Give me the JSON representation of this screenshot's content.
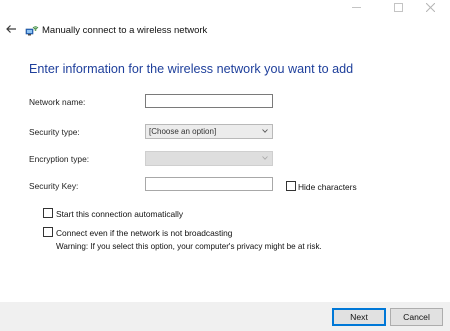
{
  "window": {
    "title": "Manually connect to a wireless network",
    "controls": {
      "minimize_icon": "minimize-icon",
      "maximize_icon": "maximize-icon",
      "close_icon": "close-icon"
    }
  },
  "nav": {
    "back_icon": "back-arrow-icon"
  },
  "heading": "Enter information for the wireless network you want to add",
  "form": {
    "network_name": {
      "label": "Network name:",
      "value": ""
    },
    "security_type": {
      "label": "Security type:",
      "selected": "[Choose an option]"
    },
    "encryption_type": {
      "label": "Encryption type:",
      "selected": "",
      "disabled": true
    },
    "security_key": {
      "label": "Security Key:",
      "value": ""
    },
    "hide_characters": {
      "label": "Hide characters",
      "checked": false
    },
    "start_auto": {
      "label": "Start this connection automatically",
      "checked": false
    },
    "connect_even": {
      "label": "Connect even if the network is not broadcasting",
      "checked": false
    },
    "warning": "Warning: If you select this option, your computer's privacy might be at risk."
  },
  "footer": {
    "next_label": "Next",
    "cancel_label": "Cancel"
  },
  "colors": {
    "heading": "#1e3f9b",
    "accent": "#0078d7",
    "footer_bg": "#f0f0f0"
  }
}
